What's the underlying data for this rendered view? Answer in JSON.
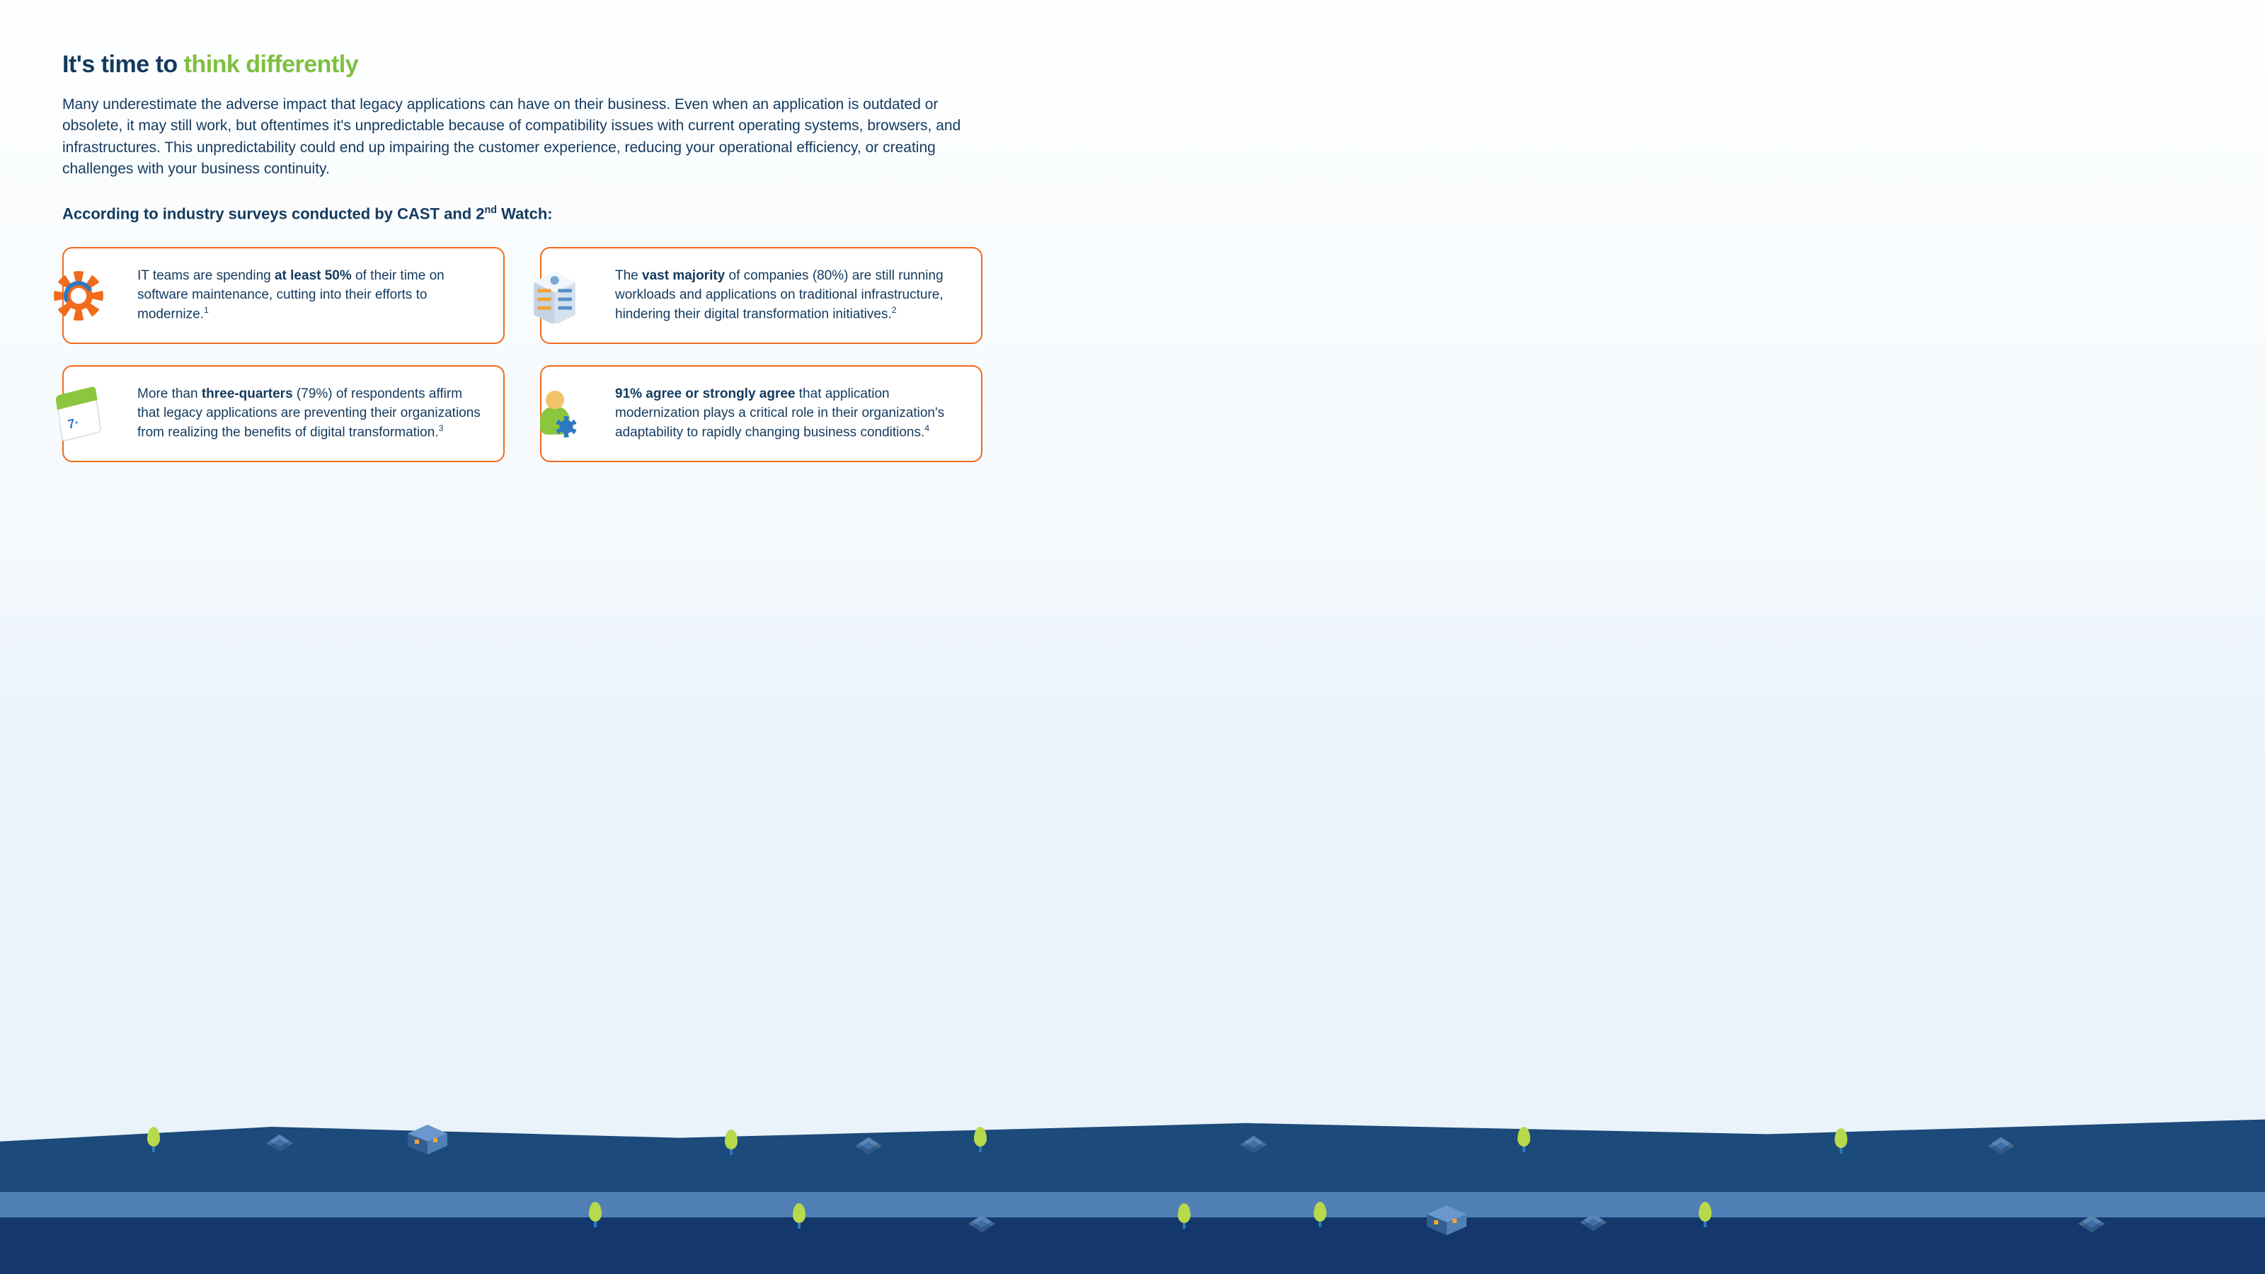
{
  "title": {
    "prefix": "It's time to ",
    "accent": "think differently"
  },
  "lead": "Many underestimate the adverse impact that legacy applications can have on their business. Even when an application is outdated or obsolete, it may still work, but oftentimes it's unpredictable because of compatibility issues with current operating systems, browsers, and infrastructures. This unpredictability could end up impairing the customer experience, reducing your operational efficiency, or creating challenges with your business continuity.",
  "subhead": {
    "before": "According to industry surveys conducted by CAST and 2",
    "sup": "nd",
    "after": " Watch:"
  },
  "cards": [
    {
      "icon": "gear-cycle-icon",
      "pre": "IT teams are spending ",
      "bold": "at least 50%",
      "post": " of their time on software maintenance, cutting into their efforts to modernize.",
      "footnote": "1"
    },
    {
      "icon": "server-building-icon",
      "pre": "The ",
      "bold": "vast majority",
      "post": " of companies (80%) are still running workloads and applications on traditional infrastructure, hindering their digital transformation initiatives.",
      "footnote": "2"
    },
    {
      "icon": "calendar-icon",
      "pre": "More than ",
      "bold": "three-quarters",
      "post": " (79%) of respondents affirm that legacy applications are preventing their organizations from realizing the benefits of digital transformation.",
      "footnote": "3"
    },
    {
      "icon": "person-gear-icon",
      "pre": "",
      "bold": "91% agree or strongly agree",
      "post": " that application modernization plays a critical role in their organization's adaptability to rapidly changing business conditions.",
      "footnote": "4"
    }
  ]
}
